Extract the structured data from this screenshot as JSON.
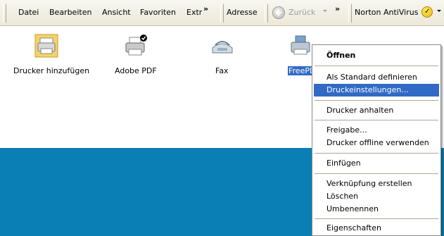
{
  "toolbar": {
    "menu": [
      "Datei",
      "Bearbeiten",
      "Ansicht",
      "Favoriten",
      "Extr"
    ],
    "address_label": "Adresse",
    "back_label": "Zurück",
    "norton_label": "Norton AntiVirus"
  },
  "icons": [
    {
      "label": "Drucker hinzufügen",
      "icon": "add-printer-icon"
    },
    {
      "label": "Adobe PDF",
      "icon": "printer-icon"
    },
    {
      "label": "Fax",
      "icon": "fax-icon"
    },
    {
      "label": "FreePD",
      "icon": "printer-icon"
    }
  ],
  "context_menu": {
    "items": [
      "Öffnen",
      "Als Standard definieren",
      "Druckeinstellungen...",
      "Drucker anhalten",
      "Freigabe...",
      "Drucker offline verwenden",
      "Einfügen",
      "Verknüpfung erstellen",
      "Löschen",
      "Umbenennen",
      "Eigenschaften"
    ],
    "selected_index": 2
  },
  "colors": {
    "selection": "#316ac5",
    "desktop": "#0a7fb5"
  }
}
